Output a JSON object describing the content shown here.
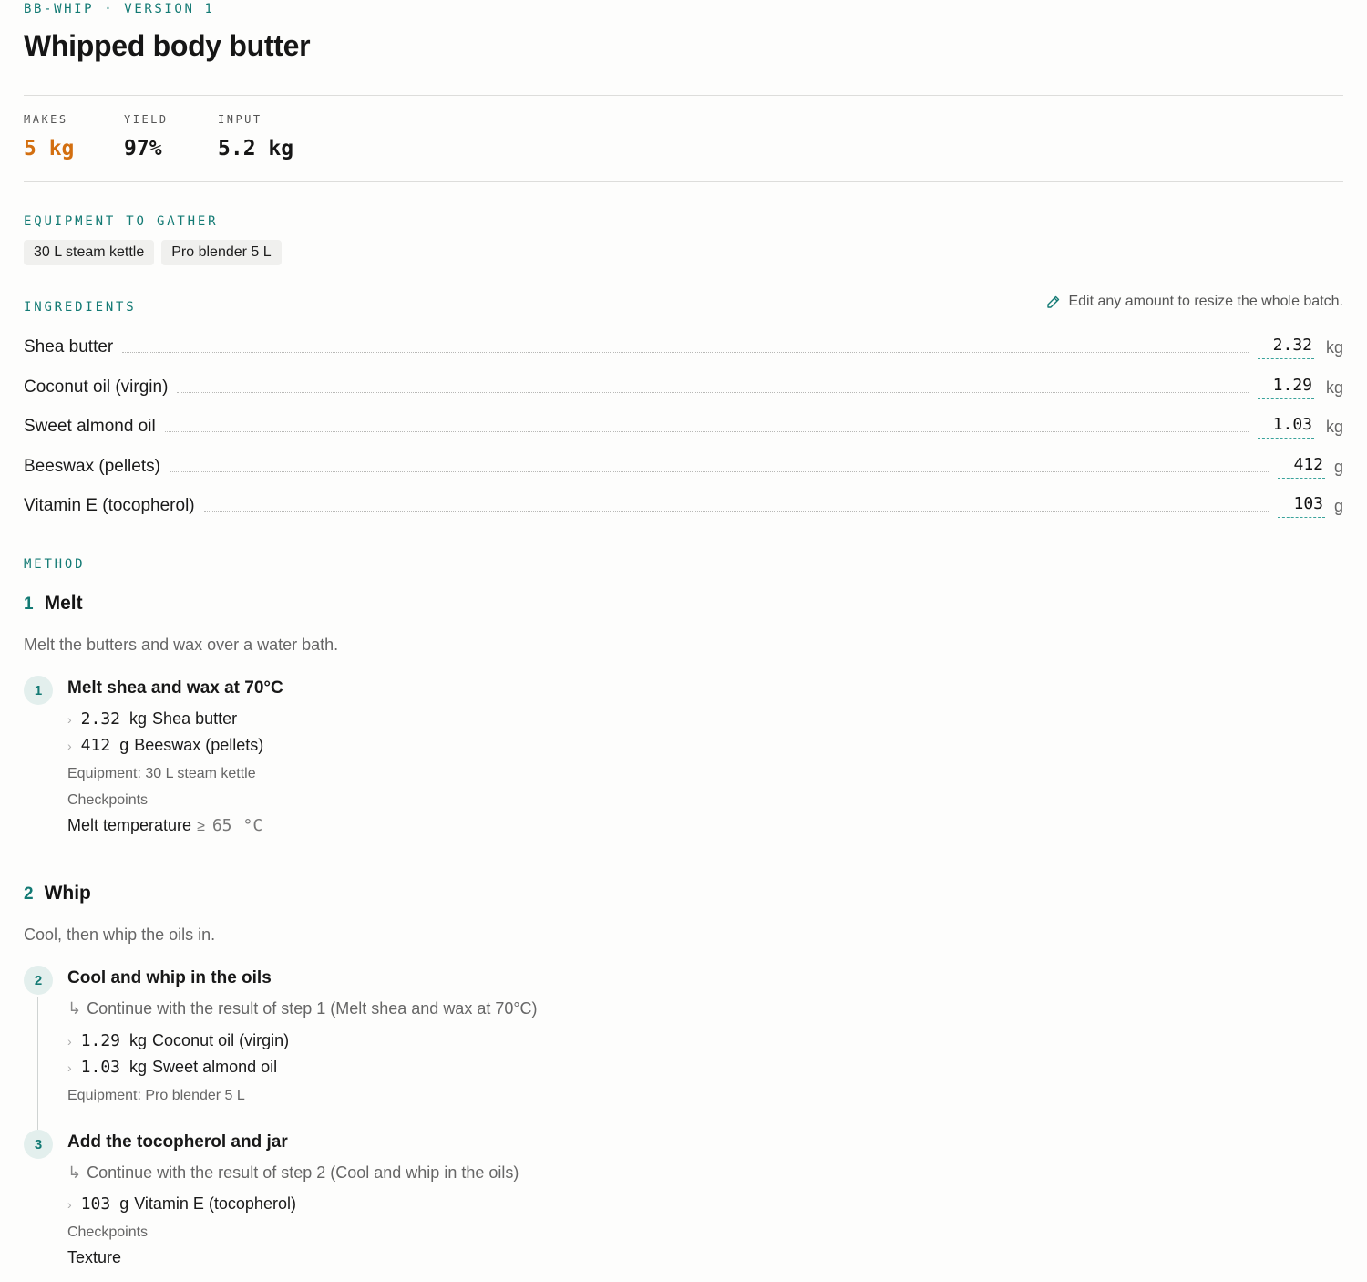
{
  "header": {
    "code": "BB-WHIP · VERSION 1",
    "title": "Whipped body butter"
  },
  "stats": [
    {
      "label": "MAKES",
      "value": "5 kg"
    },
    {
      "label": "YIELD",
      "value": "97%"
    },
    {
      "label": "INPUT",
      "value": "5.2 kg"
    }
  ],
  "equipment": {
    "label": "EQUIPMENT TO GATHER",
    "items": [
      "30 L steam kettle",
      "Pro blender 5 L"
    ]
  },
  "ingredients": {
    "label": "INGREDIENTS",
    "hint": "Edit any amount to resize the whole batch.",
    "items": [
      {
        "name": "Shea butter",
        "amount": "2.32",
        "unit": "kg"
      },
      {
        "name": "Coconut oil (virgin)",
        "amount": "1.29",
        "unit": "kg"
      },
      {
        "name": "Sweet almond oil",
        "amount": "1.03",
        "unit": "kg"
      },
      {
        "name": "Beeswax (pellets)",
        "amount": "412",
        "unit": "g"
      },
      {
        "name": "Vitamin E (tocopherol)",
        "amount": "103",
        "unit": "g"
      }
    ]
  },
  "method": {
    "label": "METHOD",
    "phases": [
      {
        "num": "1",
        "title": "Melt",
        "desc": "Melt the butters and wax over a water bath.",
        "steps": [
          {
            "num": "1",
            "title": "Melt shea and wax at 70°C",
            "ingredients": [
              {
                "qty": "2.32",
                "unit": "kg",
                "name": "Shea butter"
              },
              {
                "qty": "412",
                "unit": "g",
                "name": "Beeswax (pellets)"
              }
            ],
            "equipment": "Equipment: 30 L steam kettle",
            "checkpoints_label": "Checkpoints",
            "checkpoint": {
              "name": "Melt temperature",
              "op": "≥",
              "value": "65",
              "unit": "°C"
            }
          }
        ]
      },
      {
        "num": "2",
        "title": "Whip",
        "desc": "Cool, then whip the oils in.",
        "steps": [
          {
            "num": "2",
            "title": "Cool and whip in the oils",
            "continue": "Continue with the result of step 1 (Melt shea and wax at 70°C)",
            "ingredients": [
              {
                "qty": "1.29",
                "unit": "kg",
                "name": "Coconut oil (virgin)"
              },
              {
                "qty": "1.03",
                "unit": "kg",
                "name": "Sweet almond oil"
              }
            ],
            "equipment": "Equipment: Pro blender 5 L"
          },
          {
            "num": "3",
            "title": "Add the tocopherol and jar",
            "continue": "Continue with the result of step 2 (Cool and whip in the oils)",
            "ingredients": [
              {
                "qty": "103",
                "unit": "g",
                "name": "Vitamin E (tocopherol)"
              }
            ],
            "checkpoints_label": "Checkpoints",
            "checkpoint_text": "Texture"
          }
        ]
      }
    ]
  }
}
